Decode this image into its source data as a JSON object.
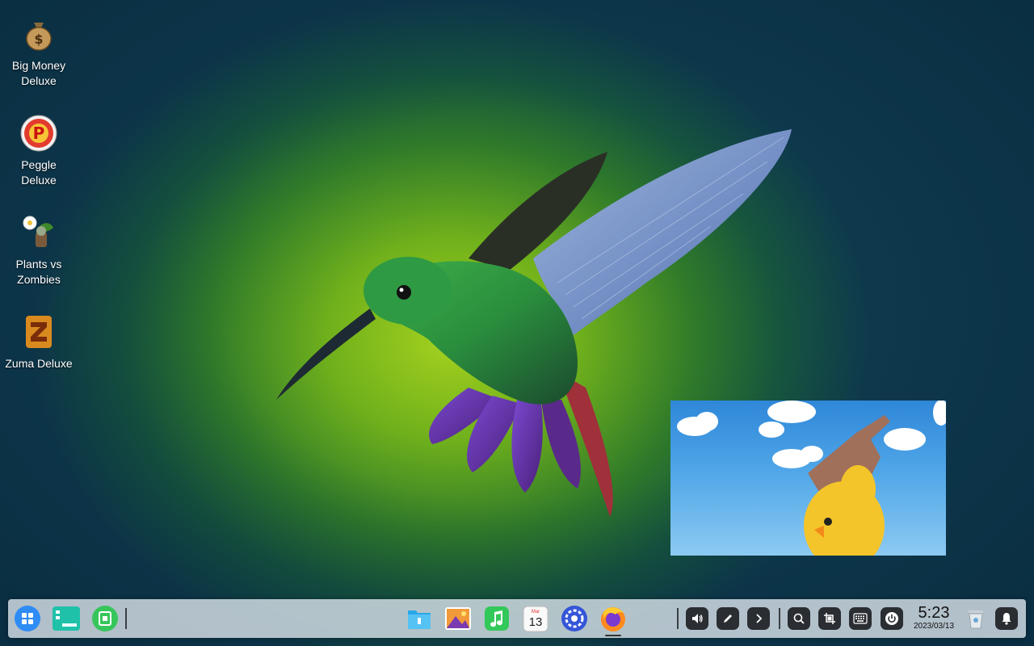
{
  "desktop": {
    "icons": [
      {
        "label": "Big Money Deluxe",
        "icon": "money-bag-icon"
      },
      {
        "label": "Peggle Deluxe",
        "icon": "peggle-icon"
      },
      {
        "label": "Plants vs Zombies",
        "icon": "plants-vs-zombies-icon"
      },
      {
        "label": "Zuma Deluxe",
        "icon": "zuma-icon"
      }
    ]
  },
  "taskbar": {
    "left_apps": [
      "launcher-icon",
      "multitask-view-icon",
      "app-store-icon"
    ],
    "pinned_apps": [
      "file-manager-icon",
      "image-viewer-icon",
      "music-icon",
      "calendar-icon",
      "settings-icon",
      "firefox-icon"
    ],
    "calendar_day": "13",
    "calendar_month": "Mar",
    "tray": [
      "volume-icon",
      "pen-icon",
      "expand-arrow-icon",
      "search-icon",
      "screenshot-icon",
      "keyboard-icon",
      "power-icon"
    ],
    "clock": {
      "time": "5:23",
      "date": "2023/03/13"
    },
    "right": [
      "trash-icon",
      "notification-bell-icon"
    ]
  },
  "colors": {
    "accent": "#2f8cf5",
    "taskbar_bg": "#d7e1e8"
  }
}
